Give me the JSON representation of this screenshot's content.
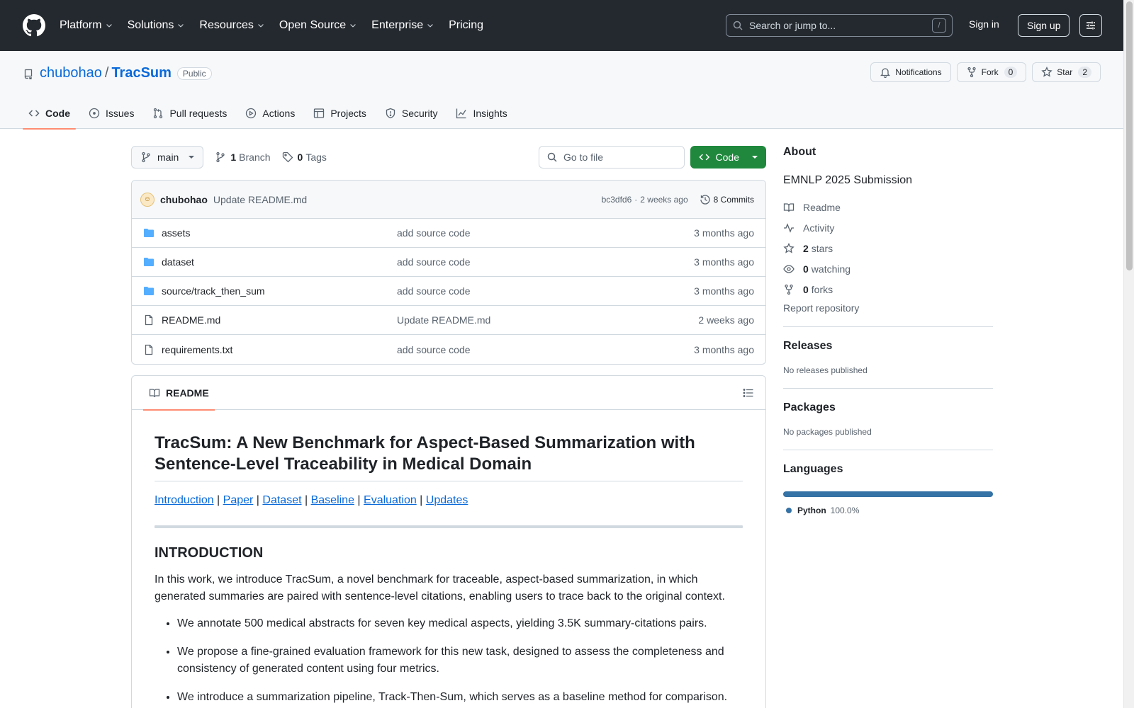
{
  "header": {
    "nav": [
      {
        "label": "Platform",
        "dropdown": true
      },
      {
        "label": "Solutions",
        "dropdown": true
      },
      {
        "label": "Resources",
        "dropdown": true
      },
      {
        "label": "Open Source",
        "dropdown": true
      },
      {
        "label": "Enterprise",
        "dropdown": true
      },
      {
        "label": "Pricing",
        "dropdown": false
      }
    ],
    "search_placeholder": "Search or jump to...",
    "search_shortcut": "/",
    "signin_label": "Sign in",
    "signup_label": "Sign up"
  },
  "repo": {
    "owner": "chubohao",
    "separator": "/",
    "name": "TracSum",
    "visibility": "Public",
    "notifications_label": "Notifications",
    "fork_label": "Fork",
    "fork_count": "0",
    "star_label": "Star",
    "star_count": "2",
    "tabs": [
      {
        "label": "Code",
        "icon": "code-icon",
        "active": true
      },
      {
        "label": "Issues",
        "icon": "issue-icon",
        "active": false
      },
      {
        "label": "Pull requests",
        "icon": "pull-request-icon",
        "active": false
      },
      {
        "label": "Actions",
        "icon": "play-icon",
        "active": false
      },
      {
        "label": "Projects",
        "icon": "table-icon",
        "active": false
      },
      {
        "label": "Security",
        "icon": "shield-icon",
        "active": false
      },
      {
        "label": "Insights",
        "icon": "graph-icon",
        "active": false
      }
    ]
  },
  "file_bar": {
    "branch": "main",
    "branch_count": "1",
    "branch_label": "Branch",
    "tag_count": "0",
    "tag_label": "Tags",
    "goto_placeholder": "Go to file",
    "code_button": "Code"
  },
  "commit": {
    "author": "chubohao",
    "message": "Update README.md",
    "hash": "bc3dfd6",
    "dot": "·",
    "time": "2 weeks ago",
    "commits_label": "8 Commits"
  },
  "files": [
    {
      "name": "assets",
      "type": "folder",
      "message": "add source code",
      "time": "3 months ago"
    },
    {
      "name": "dataset",
      "type": "folder",
      "message": "add source code",
      "time": "3 months ago"
    },
    {
      "name": "source/track_then_sum",
      "type": "folder",
      "message": "add source code",
      "time": "3 months ago"
    },
    {
      "name": "README.md",
      "type": "file",
      "message": "Update README.md",
      "time": "2 weeks ago"
    },
    {
      "name": "requirements.txt",
      "type": "file",
      "message": "add source code",
      "time": "3 months ago"
    }
  ],
  "readme": {
    "tab_label": "README",
    "title": "TracSum: A New Benchmark for Aspect-Based Summarization with Sentence-Level Traceability in Medical Domain",
    "links": [
      "Introduction",
      "Paper",
      "Dataset",
      "Baseline",
      "Evaluation",
      "Updates"
    ],
    "link_separator": " | ",
    "intro_heading": "INTRODUCTION",
    "intro_text": "In this work, we introduce TracSum, a novel benchmark for traceable, aspect-based summarization, in which generated summaries are paired with sentence-level citations, enabling users to trace back to the original context.",
    "bullets": [
      "We annotate 500 medical abstracts for seven key medical aspects, yielding 3.5K summary-citations pairs.",
      "We propose a fine-grained evaluation framework for this new task, designed to assess the completeness and consistency of generated content using four metrics.",
      "We introduce a summarization pipeline, Track-Then-Sum, which serves as a baseline method for comparison."
    ]
  },
  "sidebar": {
    "about_heading": "About",
    "description": "EMNLP 2025 Submission",
    "items": [
      {
        "icon": "book-icon",
        "count": "",
        "label": "Readme"
      },
      {
        "icon": "pulse-icon",
        "count": "",
        "label": "Activity"
      },
      {
        "icon": "star-icon",
        "count": "2",
        "label": "stars"
      },
      {
        "icon": "eye-icon",
        "count": "0",
        "label": "watching"
      },
      {
        "icon": "fork-icon",
        "count": "0",
        "label": "forks"
      }
    ],
    "report_label": "Report repository",
    "releases_heading": "Releases",
    "releases_text": "No releases published",
    "packages_heading": "Packages",
    "packages_text": "No packages published",
    "languages_heading": "Languages",
    "languages": [
      {
        "name": "Python",
        "percent": "100.0%",
        "fraction": 1.0,
        "color": "#3572A5"
      }
    ]
  },
  "colors": {
    "header_bg": "#24292f",
    "link": "#0969da",
    "primary_button": "#1f883d",
    "active_tab_underline": "#fd8c73",
    "folder_icon": "#54aeff"
  }
}
